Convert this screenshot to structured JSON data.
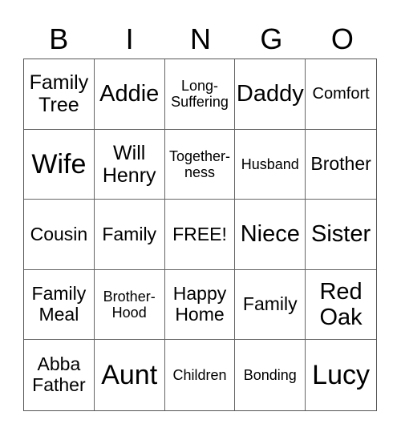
{
  "header": {
    "letters": [
      "B",
      "I",
      "N",
      "G",
      "O"
    ]
  },
  "board": {
    "rows": [
      [
        {
          "text": "Family\nTree",
          "size": "s-ml"
        },
        {
          "text": "Addie",
          "size": "s-lg"
        },
        {
          "text": "Long-\nSuffering",
          "size": "s-xs"
        },
        {
          "text": "Daddy",
          "size": "s-lg"
        },
        {
          "text": "Comfort",
          "size": "s-sm"
        }
      ],
      [
        {
          "text": "Wife",
          "size": "s-xl"
        },
        {
          "text": "Will\nHenry",
          "size": "s-ml"
        },
        {
          "text": "Together-\nness",
          "size": "s-xs"
        },
        {
          "text": "Husband",
          "size": "s-xs"
        },
        {
          "text": "Brother",
          "size": "s-md"
        }
      ],
      [
        {
          "text": "Cousin",
          "size": "s-md"
        },
        {
          "text": "Family",
          "size": "s-md"
        },
        {
          "text": "FREE!",
          "size": "s-md"
        },
        {
          "text": "Niece",
          "size": "s-lg"
        },
        {
          "text": "Sister",
          "size": "s-lg"
        }
      ],
      [
        {
          "text": "Family\nMeal",
          "size": "s-md"
        },
        {
          "text": "Brother-\nHood",
          "size": "s-xs"
        },
        {
          "text": "Happy\nHome",
          "size": "s-md"
        },
        {
          "text": "Family",
          "size": "s-md"
        },
        {
          "text": "Red\nOak",
          "size": "s-lg"
        }
      ],
      [
        {
          "text": "Abba\nFather",
          "size": "s-md"
        },
        {
          "text": "Aunt",
          "size": "s-xl"
        },
        {
          "text": "Children",
          "size": "s-xs"
        },
        {
          "text": "Bonding",
          "size": "s-xs"
        },
        {
          "text": "Lucy",
          "size": "s-xl"
        }
      ]
    ]
  }
}
